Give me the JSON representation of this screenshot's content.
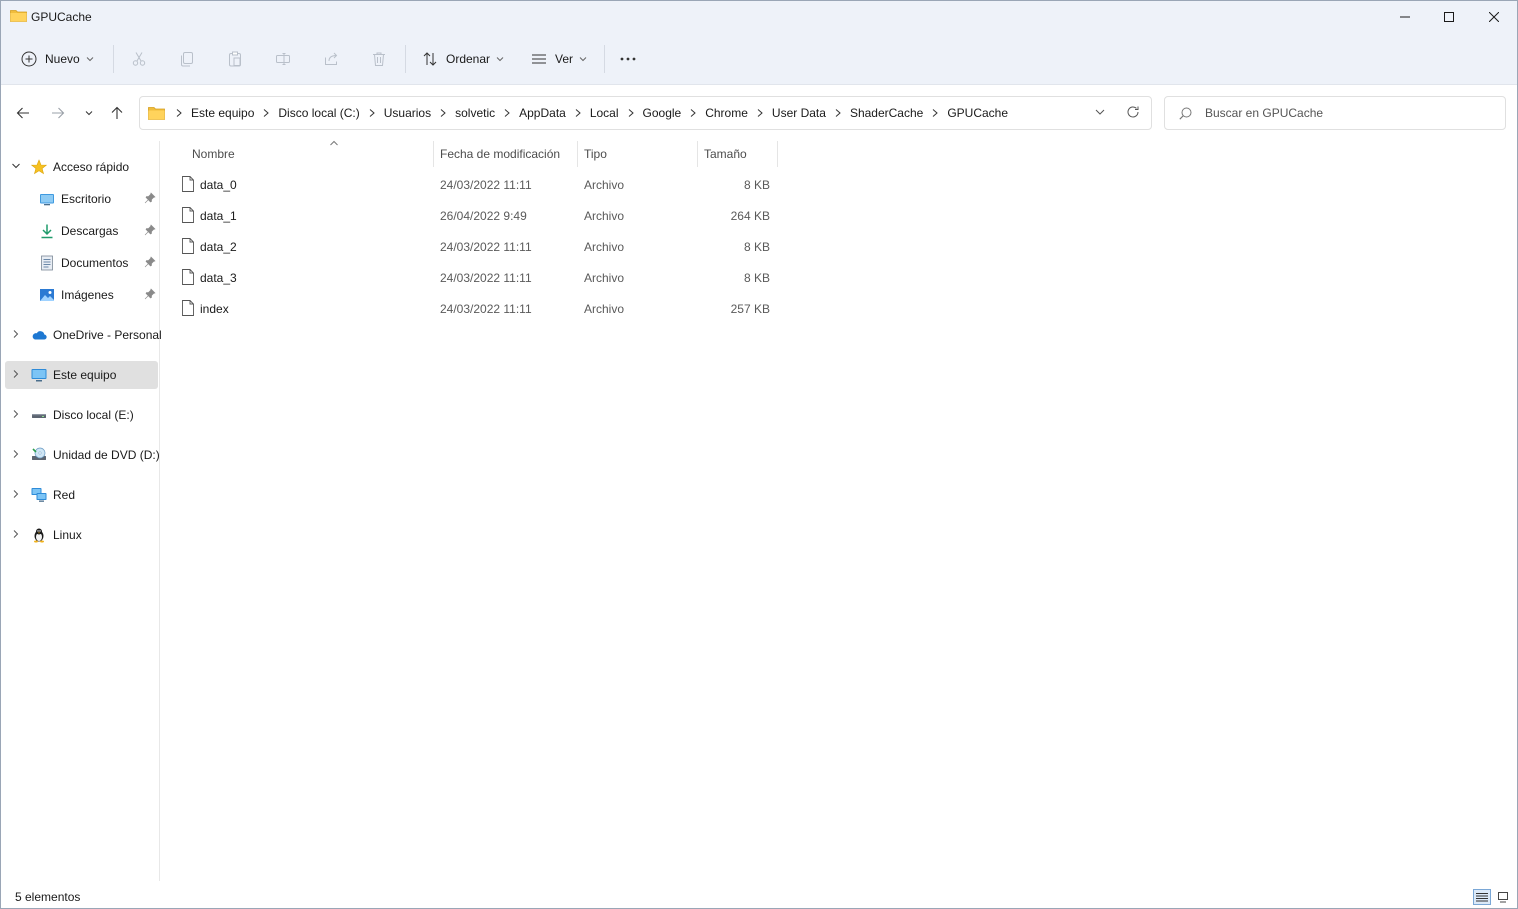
{
  "window": {
    "title": "GPUCache",
    "minimize_icon": "minimize-icon",
    "maximize_icon": "maximize-icon",
    "close_icon": "close-icon"
  },
  "toolbar": {
    "new_label": "Nuevo",
    "sort_label": "Ordenar",
    "view_label": "Ver",
    "icons": [
      "plus-circle-icon",
      "cut-icon",
      "copy-icon",
      "paste-icon",
      "rename-icon",
      "share-icon",
      "delete-icon",
      "sort-icon",
      "view-icon",
      "more-icon"
    ]
  },
  "address": {
    "crumbs": [
      "Este equipo",
      "Disco local (C:)",
      "Usuarios",
      "solvetic",
      "AppData",
      "Local",
      "Google",
      "Chrome",
      "User Data",
      "ShaderCache",
      "GPUCache"
    ]
  },
  "search": {
    "placeholder": "Buscar en GPUCache"
  },
  "sidebar": {
    "quick_access": "Acceso rápido",
    "quick_items": [
      {
        "label": "Escritorio",
        "icon": "desktop-icon"
      },
      {
        "label": "Descargas",
        "icon": "download-icon"
      },
      {
        "label": "Documentos",
        "icon": "documents-icon"
      },
      {
        "label": "Imágenes",
        "icon": "pictures-icon"
      }
    ],
    "roots": [
      {
        "label": "OneDrive - Personal",
        "icon": "onedrive-icon"
      },
      {
        "label": "Este equipo",
        "icon": "computer-icon",
        "selected": true
      },
      {
        "label": "Disco local (E:)",
        "icon": "drive-icon"
      },
      {
        "label": "Unidad de DVD (D:)",
        "icon": "dvd-icon"
      },
      {
        "label": "Red",
        "icon": "network-icon"
      },
      {
        "label": "Linux",
        "icon": "linux-icon"
      }
    ]
  },
  "columns": {
    "name": "Nombre",
    "date": "Fecha de modificación",
    "type": "Tipo",
    "size": "Tamaño"
  },
  "files": [
    {
      "name": "data_0",
      "date": "24/03/2022 11:11",
      "type": "Archivo",
      "size": "8 KB"
    },
    {
      "name": "data_1",
      "date": "26/04/2022 9:49",
      "type": "Archivo",
      "size": "264 KB"
    },
    {
      "name": "data_2",
      "date": "24/03/2022 11:11",
      "type": "Archivo",
      "size": "8 KB"
    },
    {
      "name": "data_3",
      "date": "24/03/2022 11:11",
      "type": "Archivo",
      "size": "8 KB"
    },
    {
      "name": "index",
      "date": "24/03/2022 11:11",
      "type": "Archivo",
      "size": "257 KB"
    }
  ],
  "status": {
    "count": "5 elementos"
  }
}
